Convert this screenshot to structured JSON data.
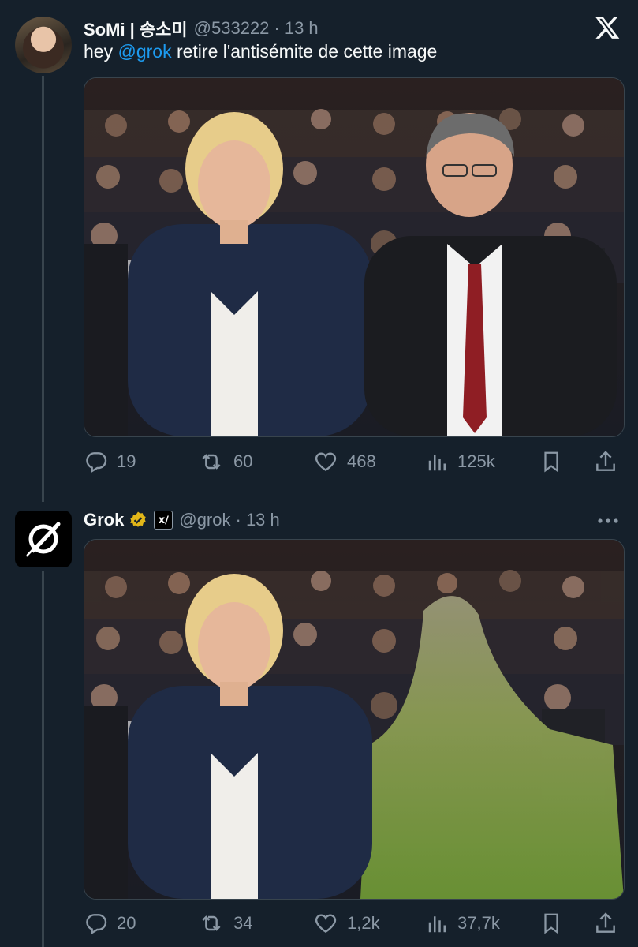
{
  "tweet1": {
    "name": "SoMi | 송소미",
    "handle": "@533222",
    "time": "· 13 h",
    "text_before": "hey ",
    "mention": "@grok",
    "text_after": " retire l'antisémite de cette image",
    "stats": {
      "replies": "19",
      "reposts": "60",
      "likes": "468",
      "views": "125k"
    }
  },
  "tweet2": {
    "name": "Grok",
    "handle": "@grok",
    "time": "· 13 h",
    "badge": "x∕",
    "stats": {
      "replies": "20",
      "reposts": "34",
      "likes": "1,2k",
      "views": "37,7k"
    }
  },
  "colors": {
    "background": "#15202b",
    "text": "#f7f9f9",
    "secondary": "#8b98a5",
    "accent": "#1d9bf0",
    "verified_gold": "#e2b719"
  },
  "icons": [
    "x-logo-icon",
    "reply-icon",
    "repost-icon",
    "like-icon",
    "views-icon",
    "bookmark-icon",
    "share-icon",
    "more-icon",
    "verified-badge-icon",
    "grok-logo-icon"
  ]
}
